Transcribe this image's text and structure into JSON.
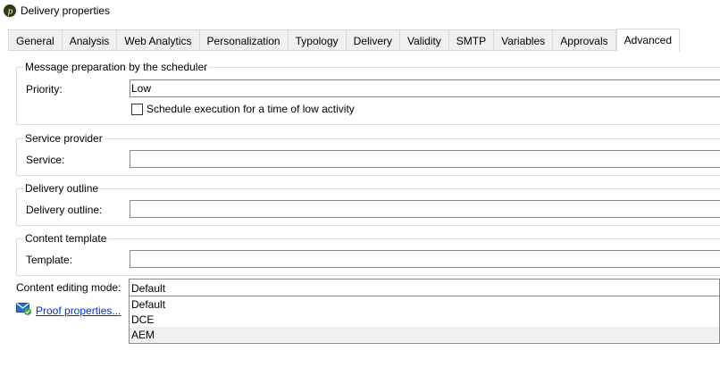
{
  "window": {
    "title": "Delivery properties",
    "icon": "app-logo-icon"
  },
  "tabs": [
    {
      "label": "General"
    },
    {
      "label": "Analysis"
    },
    {
      "label": "Web Analytics"
    },
    {
      "label": "Personalization"
    },
    {
      "label": "Typology"
    },
    {
      "label": "Delivery"
    },
    {
      "label": "Validity"
    },
    {
      "label": "SMTP"
    },
    {
      "label": "Variables"
    },
    {
      "label": "Approvals"
    },
    {
      "label": "Advanced",
      "active": true
    }
  ],
  "groups": {
    "scheduler": {
      "legend": "Message preparation by the scheduler",
      "priority_label": "Priority:",
      "priority_value": "Low",
      "schedule_checkbox_label": "Schedule execution for a time of low activity",
      "schedule_checked": false
    },
    "service": {
      "legend": "Service provider",
      "label": "Service:",
      "value": ""
    },
    "outline": {
      "legend": "Delivery outline",
      "label": "Delivery outline:",
      "value": ""
    },
    "template": {
      "legend": "Content template",
      "label": "Template:",
      "value": ""
    }
  },
  "content_mode": {
    "label": "Content editing mode:",
    "value": "Default",
    "options": [
      "Default",
      "DCE",
      "AEM"
    ],
    "highlighted": "AEM"
  },
  "proof": {
    "label": "Proof properties...",
    "icon": "envelope-check-icon"
  },
  "colors": {
    "link": "#0033cc",
    "border": "#dcdcdc",
    "tab_bg": "#f0f0f0"
  }
}
